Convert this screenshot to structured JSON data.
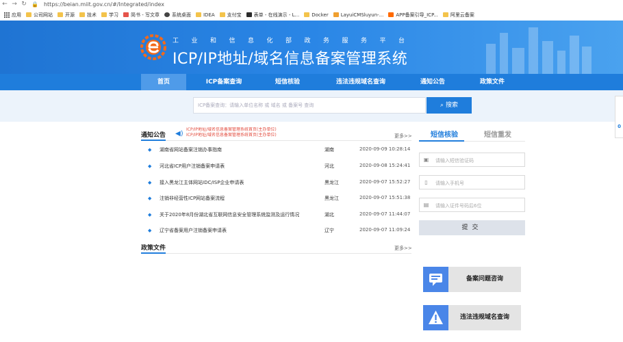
{
  "browser": {
    "url": "https://beian.miit.gov.cn/#/Integrated/index",
    "bookmarks": [
      {
        "label": "应用",
        "icon": "apps-icon"
      },
      {
        "label": "公司网站",
        "icon": "folder-icon"
      },
      {
        "label": "开源",
        "icon": "folder-icon"
      },
      {
        "label": "技术",
        "icon": "folder-icon"
      },
      {
        "label": "学习",
        "icon": "folder-icon"
      },
      {
        "label": "简书 - 写文章",
        "icon": "jianshu-icon"
      },
      {
        "label": "系统桌面",
        "icon": "system-icon"
      },
      {
        "label": "IDEA",
        "icon": "folder-icon"
      },
      {
        "label": "支付宝",
        "icon": "folder-icon"
      },
      {
        "label": "表单 - 在线演示 - L...",
        "icon": "layui-icon"
      },
      {
        "label": "Docker",
        "icon": "folder-icon"
      },
      {
        "label": "LayuiCMSluyun-...",
        "icon": "layui-cms-icon"
      },
      {
        "label": "APP备案引导_ICP...",
        "icon": "app-icon"
      },
      {
        "label": "阿里云备案",
        "icon": "folder-icon"
      }
    ]
  },
  "header": {
    "subtitle": "工业和信息化部政务服务平台",
    "title": "ICP/IP地址/域名信息备案管理系统"
  },
  "nav": {
    "items": [
      {
        "label": "首页"
      },
      {
        "label": "ICP备案查询"
      },
      {
        "label": "短信核验"
      },
      {
        "label": "违法违规域名查询"
      },
      {
        "label": "通知公告"
      },
      {
        "label": "政策文件"
      }
    ]
  },
  "search": {
    "placeholder": "ICP备案查询：请输入单位名称 或 域名 或 备案号 查询",
    "button_label": "搜索"
  },
  "notices": {
    "title": "通知公告",
    "more": "更多>>",
    "ticker": [
      "ICP/IP地址/域名信息备案管理系统首页(主办单位)",
      "ICP/IP地址/域名信息备案管理系统首页(主办单位)"
    ],
    "rows": [
      {
        "title": "湖南省网站备案注销办事指南",
        "province": "湖南",
        "date": "2020-09-09 10:28:14"
      },
      {
        "title": "河北省ICP用户注销备案申请表",
        "province": "河北",
        "date": "2020-09-08 15:24:41"
      },
      {
        "title": "接入黑龙江主体网站IDC/ISP企业申请表",
        "province": "黑龙江",
        "date": "2020-09-07 15:52:27"
      },
      {
        "title": "注销非经营性ICP网站备案流程",
        "province": "黑龙江",
        "date": "2020-09-07 15:51:38"
      },
      {
        "title": "关于2020年8月份湖北省互联网信息安全管理系统监测及运行情况",
        "province": "湖北",
        "date": "2020-09-07 11:44:07"
      },
      {
        "title": "辽宁省备案用户注销备案申请表",
        "province": "辽宁",
        "date": "2020-09-07 11:09:24"
      }
    ]
  },
  "policy": {
    "title": "政策文件",
    "more": "更多>>"
  },
  "sms": {
    "tab_active": "短信核验",
    "tab_other": "短信重发",
    "fields": [
      {
        "placeholder": "请输入短信验证码",
        "icon": "sms-icon"
      },
      {
        "placeholder": "请输入手机号",
        "icon": "phone-icon"
      },
      {
        "placeholder": "请输入证件号码后6位",
        "icon": "id-card-icon"
      }
    ],
    "submit": "提交"
  },
  "cards": [
    {
      "label": "备案问题咨询",
      "icon": "consult-icon"
    },
    {
      "label": "违法违规域名查询",
      "icon": "warning-icon"
    }
  ],
  "side_tab": {
    "label": "0"
  }
}
